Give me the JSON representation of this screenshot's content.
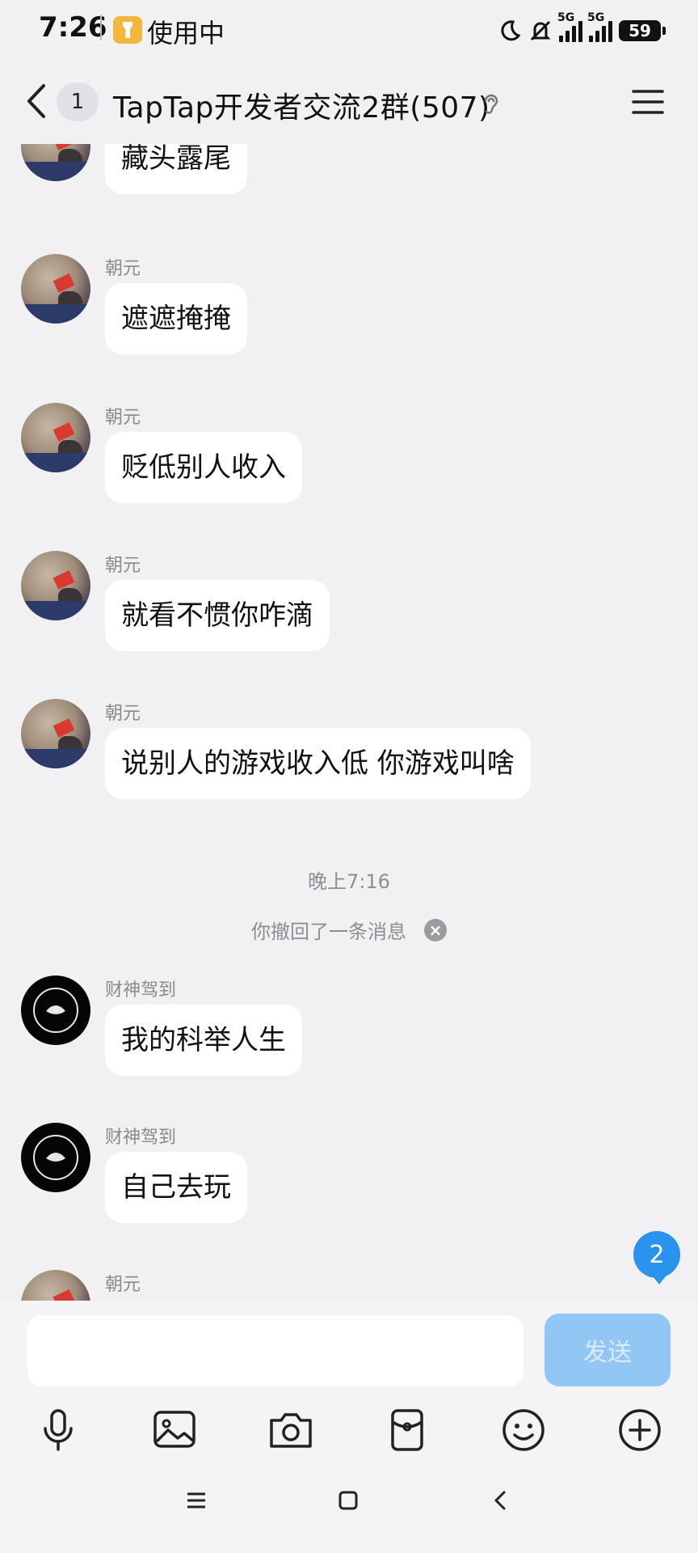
{
  "status_bar": {
    "time": "7:26",
    "app_label": "使用中",
    "network_1": "5G",
    "network_2": "5G",
    "battery": "59"
  },
  "nav": {
    "back_icon": "chevron-left-icon",
    "unread_count": "1",
    "title": "TapTap开发者交流2群(507)",
    "ear_icon": "ear-icon",
    "menu_icon": "hamburger-menu-icon"
  },
  "messages": [
    {
      "sender": "",
      "text": "藏头露尾",
      "avatar": "room"
    },
    {
      "sender": "朝元",
      "text": "遮遮掩掩",
      "avatar": "room"
    },
    {
      "sender": "朝元",
      "text": "贬低别人收入",
      "avatar": "room"
    },
    {
      "sender": "朝元",
      "text": "就看不惯你咋滴",
      "avatar": "room"
    },
    {
      "sender": "朝元",
      "text": "说别人的游戏收入低 你游戏叫啥",
      "avatar": "room"
    },
    {
      "sender": "财神驾到",
      "text": "我的科举人生",
      "avatar": "gymshark"
    },
    {
      "sender": "财神驾到",
      "text": "自己去玩",
      "avatar": "gymshark"
    },
    {
      "sender": "朝元",
      "text": "",
      "avatar": "room"
    }
  ],
  "timestamp": "晚上7:16",
  "recall_notice": "你撤回了一条消息",
  "new_message_badge": "2",
  "composer": {
    "input_value": "",
    "send_label": "发送"
  },
  "toolbar_icons": [
    "microphone-icon",
    "image-icon",
    "camera-icon",
    "red-packet-icon",
    "emoji-icon",
    "plus-icon"
  ],
  "colors": {
    "background": "#f1f1f4",
    "accent": "#2a93ee",
    "send_disabled": "#92c6f4",
    "bubble": "#ffffff"
  }
}
